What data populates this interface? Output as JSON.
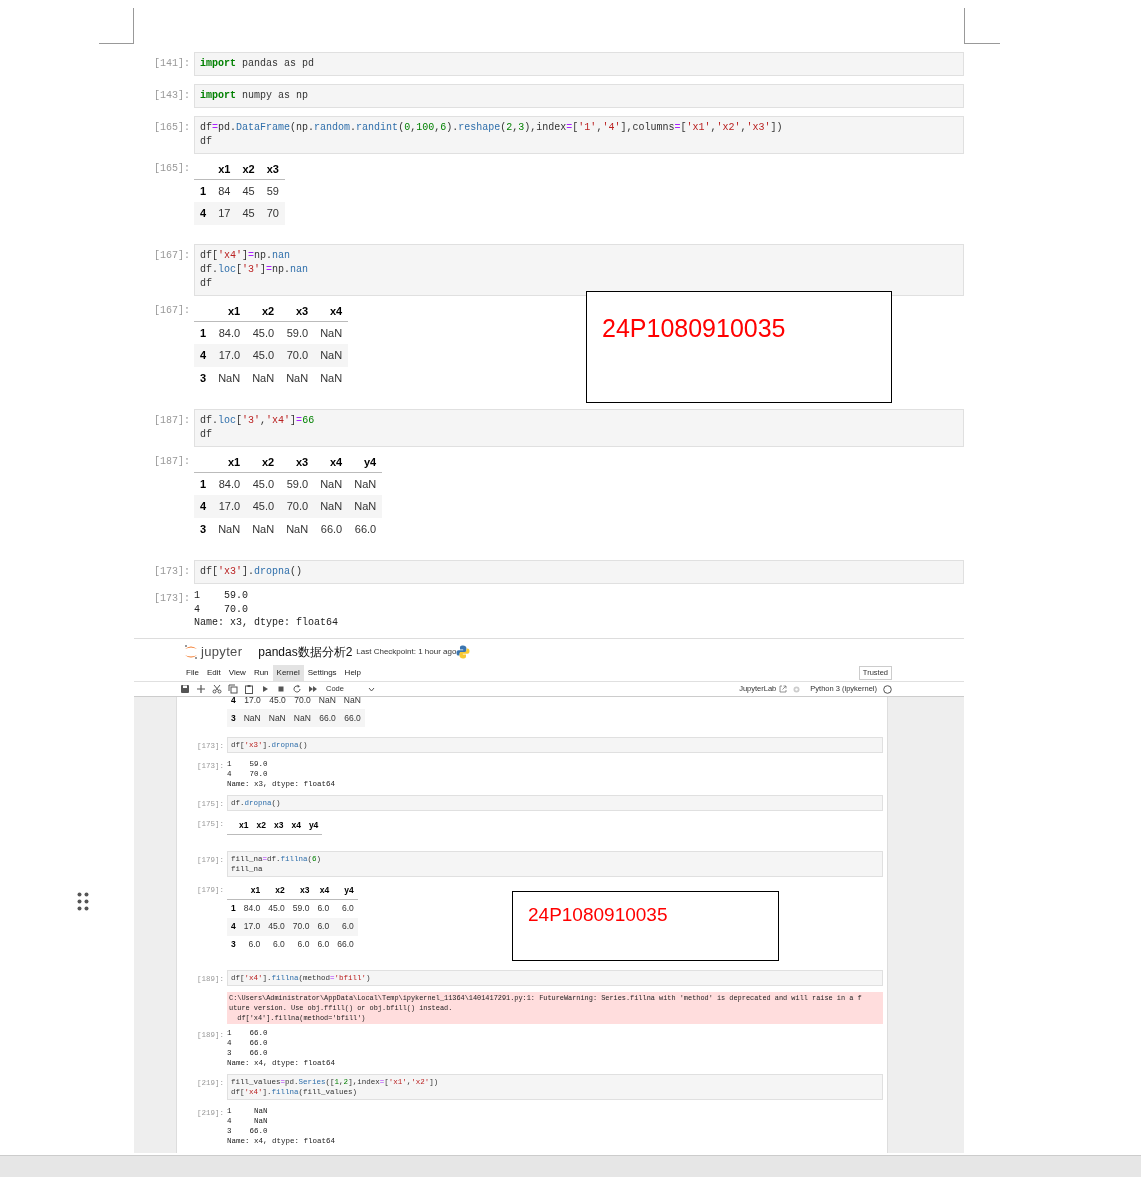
{
  "document_notebook": {
    "cells": [
      {
        "prompt": "[141]:",
        "code": [
          "import pandas as pd"
        ]
      },
      {
        "prompt": "[143]:",
        "code": [
          "import numpy as np"
        ]
      },
      {
        "prompt": "[165]:",
        "code": [
          "df=pd.DataFrame(np.random.randint(0,100,6).reshape(2,3),index=['1','4'],columns=['x1','x2','x3'])",
          "df"
        ],
        "output": {
          "kind": "table",
          "prompt": "[165]:",
          "columns": [
            "x1",
            "x2",
            "x3"
          ],
          "rows": [
            {
              "index": "1",
              "cells": [
                "84",
                "45",
                "59"
              ]
            },
            {
              "index": "4",
              "cells": [
                "17",
                "45",
                "70"
              ]
            }
          ]
        }
      },
      {
        "prompt": "[167]:",
        "code": [
          "df['x4']=np.nan",
          "df.loc['3']=np.nan",
          "df"
        ],
        "output": {
          "kind": "table",
          "prompt": "[167]:",
          "columns": [
            "x1",
            "x2",
            "x3",
            "x4"
          ],
          "rows": [
            {
              "index": "1",
              "cells": [
                "84.0",
                "45.0",
                "59.0",
                "NaN"
              ]
            },
            {
              "index": "4",
              "cells": [
                "17.0",
                "45.0",
                "70.0",
                "NaN"
              ]
            },
            {
              "index": "3",
              "cells": [
                "NaN",
                "NaN",
                "NaN",
                "NaN"
              ]
            }
          ]
        }
      },
      {
        "prompt": "[187]:",
        "code": [
          "df.loc['3','x4']=66",
          "df"
        ],
        "output": {
          "kind": "table",
          "prompt": "[187]:",
          "columns": [
            "x1",
            "x2",
            "x3",
            "x4",
            "y4"
          ],
          "rows": [
            {
              "index": "1",
              "cells": [
                "84.0",
                "45.0",
                "59.0",
                "NaN",
                "NaN"
              ]
            },
            {
              "index": "4",
              "cells": [
                "17.0",
                "45.0",
                "70.0",
                "NaN",
                "NaN"
              ]
            },
            {
              "index": "3",
              "cells": [
                "NaN",
                "NaN",
                "NaN",
                "66.0",
                "66.0"
              ]
            }
          ]
        }
      },
      {
        "prompt": "[173]:",
        "code": [
          "df['x3'].dropna()"
        ],
        "output": {
          "kind": "text",
          "prompt": "[173]:",
          "lines": [
            "1    59.0",
            "4    70.0",
            "Name: x3, dtype: float64"
          ]
        }
      }
    ]
  },
  "text_boxes": [
    {
      "text": "24P1080910035"
    },
    {
      "text": "24P1080910035"
    }
  ],
  "jupyter_screenshot": {
    "logo": "jupyter",
    "title": "pandas数据分析2",
    "checkpoint": "Last Checkpoint: 1 hour ago",
    "menu": [
      {
        "label": "File",
        "selected": false
      },
      {
        "label": "Edit",
        "selected": false
      },
      {
        "label": "View",
        "selected": false
      },
      {
        "label": "Run",
        "selected": false
      },
      {
        "label": "Kernel",
        "selected": true
      },
      {
        "label": "Settings",
        "selected": false
      },
      {
        "label": "Help",
        "selected": false
      }
    ],
    "trusted": "Trusted",
    "cell_type": "Code",
    "jupyterlab": "JupyterLab",
    "kernel": "Python 3 (ipykernel)",
    "partial_table": {
      "rows": [
        {
          "index": "4",
          "cells": [
            "17.0",
            "45.0",
            "70.0",
            "NaN",
            "NaN"
          ]
        },
        {
          "index": "3",
          "cells": [
            "NaN",
            "NaN",
            "NaN",
            "66.0",
            "66.0"
          ]
        }
      ]
    },
    "cells": [
      {
        "prompt": "[173]:",
        "code": [
          "df['x3'].dropna()"
        ],
        "outputs": [
          {
            "kind": "text",
            "prompt": "[173]:",
            "lines": [
              "1    59.0",
              "4    70.0",
              "Name: x3, dtype: float64"
            ]
          }
        ]
      },
      {
        "prompt": "[175]:",
        "code": [
          "df.dropna()"
        ],
        "outputs": [
          {
            "kind": "table",
            "prompt": "[175]:",
            "columns": [
              "x1",
              "x2",
              "x3",
              "x4",
              "y4"
            ]
          }
        ]
      },
      {
        "prompt": "[179]:",
        "code": [
          "fill_na=df.fillna(6)",
          "fill_na"
        ],
        "outputs": [
          {
            "kind": "table",
            "prompt": "[179]:",
            "columns": [
              "x1",
              "x2",
              "x3",
              "x4",
              "y4"
            ],
            "rows": [
              {
                "index": "1",
                "cells": [
                  "84.0",
                  "45.0",
                  "59.0",
                  "6.0",
                  "6.0"
                ]
              },
              {
                "index": "4",
                "cells": [
                  "17.0",
                  "45.0",
                  "70.0",
                  "6.0",
                  "6.0"
                ]
              },
              {
                "index": "3",
                "cells": [
                  "6.0",
                  "6.0",
                  "6.0",
                  "6.0",
                  "66.0"
                ]
              }
            ]
          }
        ]
      },
      {
        "prompt": "[189]:",
        "code": [
          "df['x4'].fillna(method='bfill')"
        ],
        "outputs": [
          {
            "kind": "error",
            "lines": [
              "C:\\Users\\Administrator\\AppData\\Local\\Temp\\ipykernel_11364\\1401417291.py:1: FutureWarning: Series.fillna with 'method' is deprecated and will raise in a f",
              "uture version. Use obj.ffill() or obj.bfill() instead.",
              "  df['x4'].fillna(method='bfill')"
            ]
          },
          {
            "kind": "text",
            "prompt": "[189]:",
            "lines": [
              "1    66.0",
              "4    66.0",
              "3    66.0",
              "Name: x4, dtype: float64"
            ]
          }
        ]
      },
      {
        "prompt": "[219]:",
        "code": [
          "fill_values=pd.Series([1,2],index=['x1','x2'])",
          "df['x4'].fillna(fill_values)"
        ],
        "outputs": [
          {
            "kind": "text",
            "prompt": "[219]:",
            "lines": [
              "1     NaN",
              "4     NaN",
              "3    66.0",
              "Name: x4, dtype: float64"
            ]
          }
        ]
      }
    ]
  }
}
